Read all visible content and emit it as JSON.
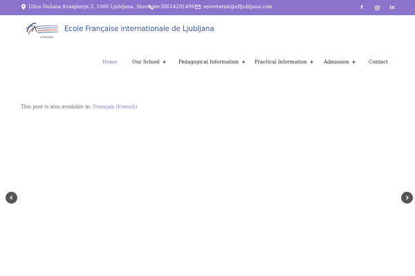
{
  "topbar": {
    "address": "Ulica Dušana Kraigherja 2, 1000 Ljubljana, Slovénie",
    "phone": "+38614291499",
    "email": "secretariat@efljubljana.com",
    "social": {
      "facebook_icon": "f",
      "instagram_icon": "instagram",
      "linkedin_icon": "in"
    },
    "bg_color": "#8b72cc"
  },
  "header": {
    "logo_caption": "LJUBLJANA",
    "site_title": "Ecole Française internationale de Ljubljana",
    "title_color": "#3b5aa3"
  },
  "nav": {
    "items": [
      {
        "label": "Home",
        "active": true
      },
      {
        "label": "Our School",
        "has_submenu": true
      },
      {
        "label": "Pedagogical Information",
        "has_submenu": true
      },
      {
        "label": "Practical Information",
        "has_submenu": true
      },
      {
        "label": "Admission",
        "has_submenu": true
      },
      {
        "label": "Contact"
      }
    ],
    "submenu_symbol": "+"
  },
  "content": {
    "notice_prefix": "This post is also available in:",
    "notice_link": "Français (French)"
  },
  "slider": {
    "prev_icon": "chevron-left",
    "next_icon": "chevron-right"
  }
}
